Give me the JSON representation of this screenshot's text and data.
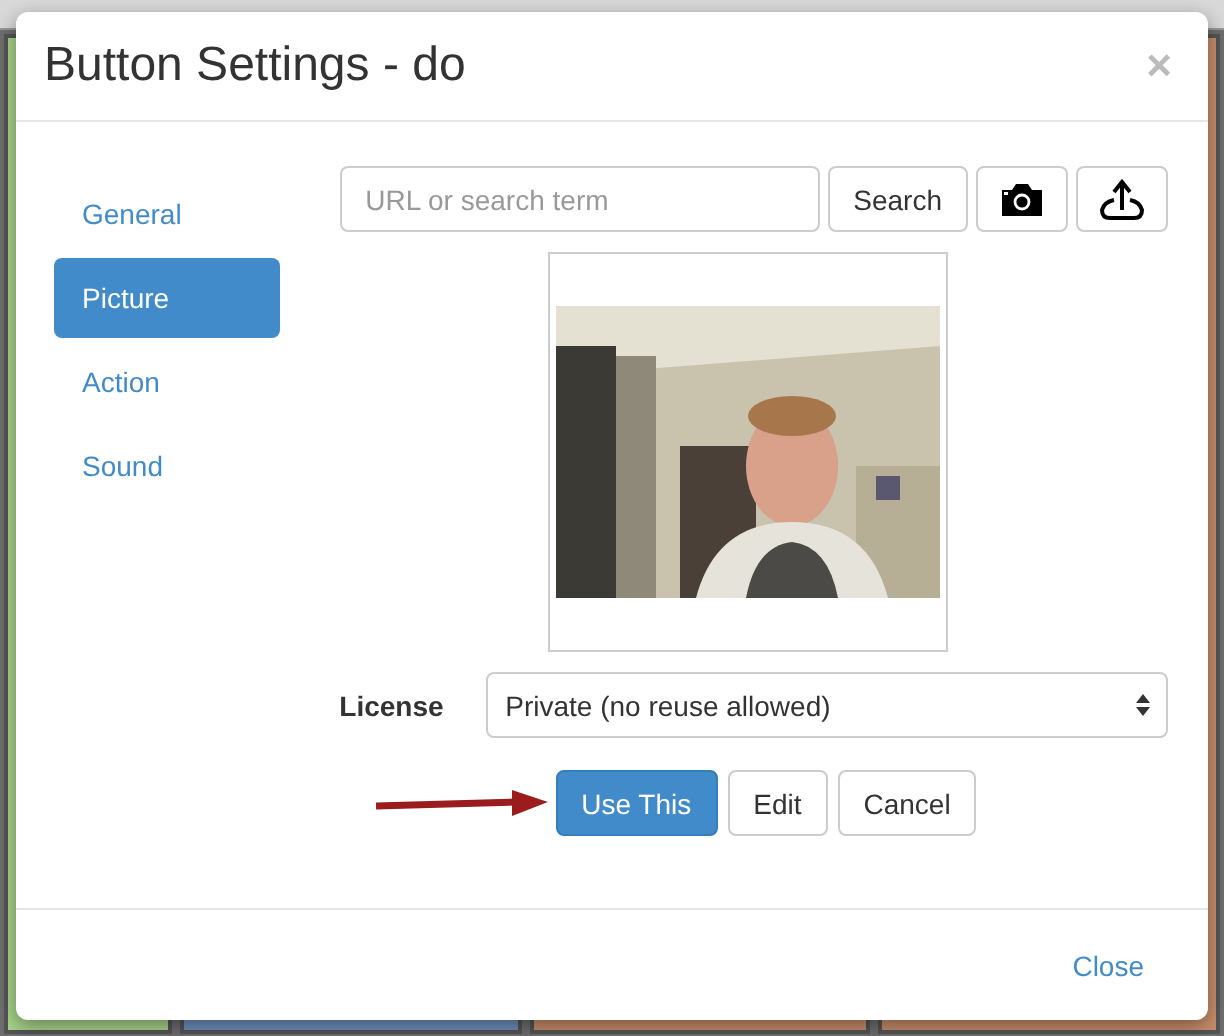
{
  "modal": {
    "title": "Button Settings - do",
    "close_glyph": "×"
  },
  "sidebar": {
    "items": [
      {
        "label": "General",
        "selected": false
      },
      {
        "label": "Picture",
        "selected": true
      },
      {
        "label": "Action",
        "selected": false
      },
      {
        "label": "Sound",
        "selected": false
      }
    ]
  },
  "search": {
    "placeholder": "URL or search term",
    "button": "Search"
  },
  "license": {
    "label": "License",
    "value": "Private (no reuse allowed)"
  },
  "actions": [
    {
      "label": "Use This",
      "kind": "primary"
    },
    {
      "label": "Edit",
      "kind": "default"
    },
    {
      "label": "Cancel",
      "kind": "default"
    }
  ],
  "footer": {
    "close": "Close"
  }
}
